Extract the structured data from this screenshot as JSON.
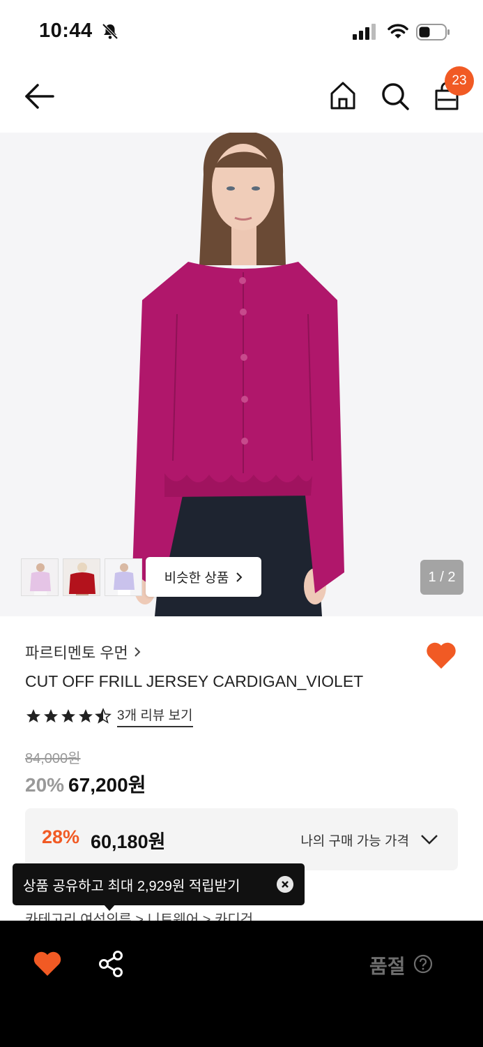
{
  "status_bar": {
    "time": "10:44",
    "battery_icon": "battery-icon",
    "wifi_icon": "wifi-icon",
    "signal_icon": "signal-icon",
    "bell_icon": "bell-off-icon"
  },
  "header": {
    "back_icon": "back-arrow-icon",
    "home_icon": "home-icon",
    "search_icon": "search-icon",
    "bag_icon": "shopping-bag-icon",
    "bag_count": "23"
  },
  "gallery": {
    "similar_label": "비슷한 상품",
    "page_indicator": "1 / 2",
    "thumbnails": [
      "lavender-cardigan",
      "red-cardigan",
      "lilac-cardigan"
    ]
  },
  "product": {
    "brand": "파르티멘토 우먼",
    "title": "CUT OFF FRILL JERSEY CARDIGAN_VIOLET",
    "rating": 4.5,
    "review_link": "3개 리뷰 보기",
    "original_price": "84,000원",
    "discount_rate": "20%",
    "sale_price": "67,200원"
  },
  "my_price": {
    "rate": "28%",
    "price": "60,180원",
    "label": "나의 구매 가능 가격"
  },
  "category_peek": "카테고리        여성의류  >  니트웨어  >  카디건",
  "toast": {
    "text": "상품 공유하고 최대 2,929원 적립받기"
  },
  "bottom_bar": {
    "soldout_label": "품절"
  },
  "colors": {
    "accent": "#f15a24",
    "cardigan": "#b0176b",
    "dark": "#111111"
  }
}
